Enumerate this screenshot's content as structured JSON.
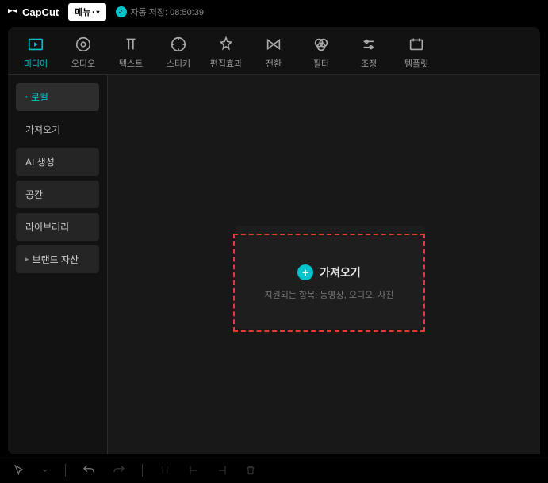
{
  "titlebar": {
    "app_name": "CapCut",
    "menu_label": "메뉴",
    "auto_save": "자동 저장: 08:50:39"
  },
  "toolbar": {
    "items": [
      {
        "label": "미디어"
      },
      {
        "label": "오디오"
      },
      {
        "label": "텍스트"
      },
      {
        "label": "스티커"
      },
      {
        "label": "편집효과"
      },
      {
        "label": "전환"
      },
      {
        "label": "필터"
      },
      {
        "label": "조정"
      },
      {
        "label": "템플릿"
      }
    ]
  },
  "sidebar": {
    "items": [
      {
        "label": "로컬"
      },
      {
        "label": "가져오기"
      },
      {
        "label": "AI 생성"
      },
      {
        "label": "공간"
      },
      {
        "label": "라이브러리"
      },
      {
        "label": "브랜드 자산"
      }
    ]
  },
  "import": {
    "title": "가져오기",
    "subtitle": "지원되는 항목: 동영상, 오디오, 사진"
  }
}
